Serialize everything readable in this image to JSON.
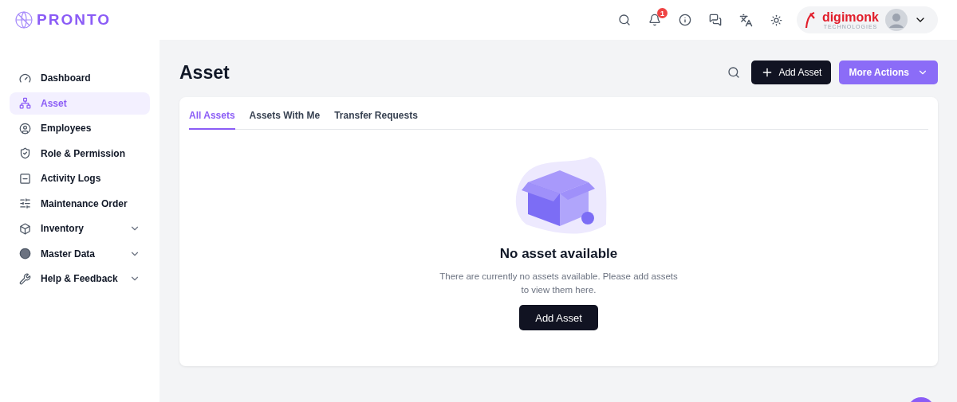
{
  "brand": {
    "name": "PRONTO"
  },
  "header": {
    "notifications": "1",
    "company": {
      "name": "digimonk",
      "tagline": "TECHNOLOGIES"
    }
  },
  "sidebar": {
    "items": [
      {
        "label": "Dashboard",
        "selected": false
      },
      {
        "label": "Asset",
        "selected": true
      },
      {
        "label": "Employees",
        "selected": false
      },
      {
        "label": "Role & Permission",
        "selected": false
      },
      {
        "label": "Activity Logs",
        "selected": false
      },
      {
        "label": "Maintenance Order",
        "selected": false
      },
      {
        "label": "Inventory",
        "selected": false,
        "expanded": false
      },
      {
        "label": "Master Data",
        "selected": false,
        "expanded": false
      },
      {
        "label": "Help & Feedback",
        "selected": false,
        "expanded": false
      }
    ]
  },
  "page": {
    "title": "Asset",
    "add_button": "Add Asset",
    "more_button": "More Actions"
  },
  "tabs": [
    {
      "label": "All Assets",
      "selected": true
    },
    {
      "label": "Assets With Me",
      "selected": false
    },
    {
      "label": "Transfer Requests",
      "selected": false
    }
  ],
  "empty_state": {
    "title": "No asset available",
    "message": "There are currently no assets available. Please add assets to view them here.",
    "button": "Add Asset"
  }
}
